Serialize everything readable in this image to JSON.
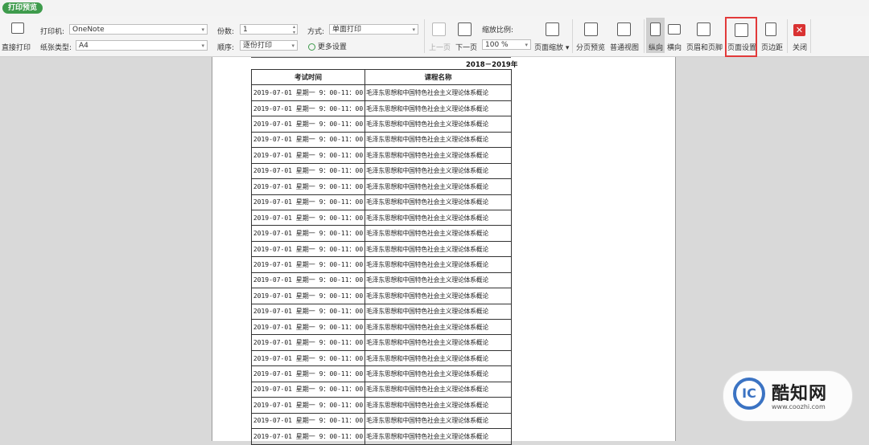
{
  "window": {
    "tab_title": "打印预览"
  },
  "toolbar": {
    "direct_print": "直接打印",
    "printer_label": "打印机:",
    "printer_value": "OneNote",
    "paper_label": "纸张类型:",
    "paper_value": "A4",
    "copies_label": "份数:",
    "copies_value": "1",
    "order_label": "顺序:",
    "order_value": "逐份打印",
    "mode_label": "方式:",
    "mode_value": "单面打印",
    "more_settings": "更多设置",
    "prev_page": "上一页",
    "next_page": "下一页",
    "zoom_label": "缩放比例:",
    "zoom_value": "100 %",
    "page_zoom": "页面缩放",
    "page_preview": "分页预览",
    "normal_view": "普通视图",
    "portrait": "纵向",
    "landscape": "横向",
    "header_footer": "页眉和页脚",
    "page_setup": "页面设置",
    "margins": "页边距",
    "close": "关闭",
    "close_glyph": "✕",
    "more_settings_icon": "gear-icon"
  },
  "sheet": {
    "year": "2018－2019年",
    "col1_header": "考试时间",
    "col2_header": "课程名称",
    "rows": [
      [
        "2019-07-01 星期一 9：00-11：00",
        "毛泽东思想和中国特色社会主义理论体系概论"
      ],
      [
        "2019-07-01 星期一 9：00-11：00",
        "毛泽东思想和中国特色社会主义理论体系概论"
      ],
      [
        "2019-07-01 星期一 9：00-11：00",
        "毛泽东思想和中国特色社会主义理论体系概论"
      ],
      [
        "2019-07-01 星期一 9：00-11：00",
        "毛泽东思想和中国特色社会主义理论体系概论"
      ],
      [
        "2019-07-01 星期一 9：00-11：00",
        "毛泽东思想和中国特色社会主义理论体系概论"
      ],
      [
        "2019-07-01 星期一 9：00-11：00",
        "毛泽东思想和中国特色社会主义理论体系概论"
      ],
      [
        "2019-07-01 星期一 9：00-11：00",
        "毛泽东思想和中国特色社会主义理论体系概论"
      ],
      [
        "2019-07-01 星期一 9：00-11：00",
        "毛泽东思想和中国特色社会主义理论体系概论"
      ],
      [
        "2019-07-01 星期一 9：00-11：00",
        "毛泽东思想和中国特色社会主义理论体系概论"
      ],
      [
        "2019-07-01 星期一 9：00-11：00",
        "毛泽东思想和中国特色社会主义理论体系概论"
      ],
      [
        "2019-07-01 星期一 9：00-11：00",
        "毛泽东思想和中国特色社会主义理论体系概论"
      ],
      [
        "2019-07-01 星期一 9：00-11：00",
        "毛泽东思想和中国特色社会主义理论体系概论"
      ],
      [
        "2019-07-01 星期一 9：00-11：00",
        "毛泽东思想和中国特色社会主义理论体系概论"
      ],
      [
        "2019-07-01 星期一 9：00-11：00",
        "毛泽东思想和中国特色社会主义理论体系概论"
      ],
      [
        "2019-07-01 星期一 9：00-11：00",
        "毛泽东思想和中国特色社会主义理论体系概论"
      ],
      [
        "2019-07-01 星期一 9：00-11：00",
        "毛泽东思想和中国特色社会主义理论体系概论"
      ],
      [
        "2019-07-01 星期一 9：00-11：00",
        "毛泽东思想和中国特色社会主义理论体系概论"
      ],
      [
        "2019-07-01 星期一 9：00-11：00",
        "毛泽东思想和中国特色社会主义理论体系概论"
      ],
      [
        "2019-07-01 星期一 9：00-11：00",
        "毛泽东思想和中国特色社会主义理论体系概论"
      ],
      [
        "2019-07-01 星期一 9：00-11：00",
        "毛泽东思想和中国特色社会主义理论体系概论"
      ],
      [
        "2019-07-01 星期一 9：00-11：00",
        "毛泽东思想和中国特色社会主义理论体系概论"
      ],
      [
        "2019-07-01 星期一 9：00-11：00",
        "毛泽东思想和中国特色社会主义理论体系概论"
      ],
      [
        "2019-07-01 星期一 9：00-11：00",
        "毛泽东思想和中国特色社会主义理论体系概论"
      ]
    ]
  },
  "watermark": {
    "brand": "酷知网",
    "url": "www.coozhi.com",
    "logo_letters": "IC"
  },
  "colors": {
    "accent_green": "#3e9b4c",
    "highlight_red": "#e23a3a",
    "close_red": "#d93232"
  }
}
